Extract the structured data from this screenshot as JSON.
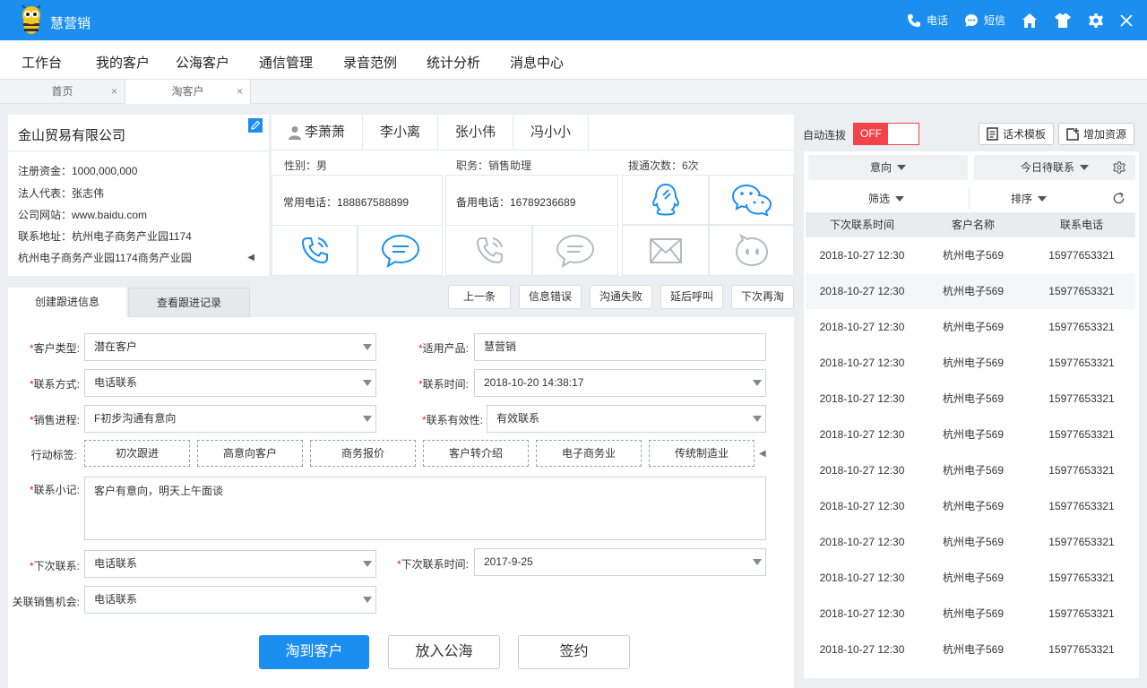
{
  "app": {
    "title": "慧营销"
  },
  "titlebar": {
    "phone_label": "电话",
    "sms_label": "短信"
  },
  "menu": [
    "工作台",
    "我的客户",
    "公海客户",
    "通信管理",
    "录音范例",
    "统计分析",
    "消息中心"
  ],
  "page_tabs": [
    {
      "label": "首页",
      "close": "×"
    },
    {
      "label": "淘客户",
      "close": "×"
    }
  ],
  "company": {
    "name": "金山贸易有限公司",
    "lines": [
      "注册资金：1000,000,000",
      "法人代表：张志伟",
      "公司网站：www.baidu.com",
      "联系地址：杭州电子商务产业园1174",
      "杭州电子商务产业园1174商务产业园"
    ]
  },
  "contacts": {
    "tabs": [
      "李萧萧",
      "李小离",
      "张小伟",
      "冯小小"
    ],
    "gender": "性别：男",
    "position": "职务：销售助理",
    "dial_count": "拨通次数：6次",
    "main_phone": "常用电话：188867588899",
    "backup_phone": "备用电话：16789236689"
  },
  "followup_tabs": [
    "创建跟进信息",
    "查看跟进记录"
  ],
  "action_buttons": [
    "上一条",
    "信息错误",
    "沟通失败",
    "延后呼叫",
    "下次再淘"
  ],
  "form": {
    "req_mark": "*",
    "customer_type": {
      "label": "客户类型:",
      "value": "潜在客户"
    },
    "product": {
      "label": "适用产品:",
      "value": "慧营销"
    },
    "contact_method": {
      "label": "联系方式:",
      "value": "电话联系"
    },
    "contact_time": {
      "label": "联系时间:",
      "value": "2018-10-20 14:38:17"
    },
    "sales_progress": {
      "label": "销售进程:",
      "value": "F初步沟通有意向"
    },
    "validity": {
      "label": "联系有效性:",
      "value": "有效联系"
    },
    "tags_label": "行动标签:",
    "tags": [
      "初次跟进",
      "高意向客户",
      "商务报价",
      "客户转介绍",
      "电子商务业",
      "传统制造业"
    ],
    "note": {
      "label": "联系小记:",
      "value": "客户有意向，明天上午面谈"
    },
    "next_contact": {
      "label": "下次联系:",
      "value": "电话联系"
    },
    "next_time": {
      "label": "下次联系时间:",
      "value": "2017-9-25"
    },
    "opportunity": {
      "label": "关联销售机会:",
      "value": "电话联系"
    }
  },
  "bottom_buttons": [
    "淘到客户",
    "放入公海",
    "签约"
  ],
  "right": {
    "auto_dial_label": "自动连拨",
    "toggle_state": "OFF",
    "script_template": "话术模板",
    "add_resource": "增加资源",
    "filter_intent": "意向",
    "filter_today": "今日待联系",
    "filter_screen": "筛选",
    "filter_sort": "排序",
    "columns": [
      "下次联系时间",
      "客户名称",
      "联系电话"
    ],
    "rows": [
      [
        "2018-10-27 12:30",
        "杭州电子569",
        "15977653321"
      ],
      [
        "2018-10-27 12:30",
        "杭州电子569",
        "15977653321"
      ],
      [
        "2018-10-27 12:30",
        "杭州电子569",
        "15977653321"
      ],
      [
        "2018-10-27 12:30",
        "杭州电子569",
        "15977653321"
      ],
      [
        "2018-10-27 12:30",
        "杭州电子569",
        "15977653321"
      ],
      [
        "2018-10-27 12:30",
        "杭州电子569",
        "15977653321"
      ],
      [
        "2018-10-27 12:30",
        "杭州电子569",
        "15977653321"
      ],
      [
        "2018-10-27 12:30",
        "杭州电子569",
        "15977653321"
      ],
      [
        "2018-10-27 12:30",
        "杭州电子569",
        "15977653321"
      ],
      [
        "2018-10-27 12:30",
        "杭州电子569",
        "15977653321"
      ],
      [
        "2018-10-27 12:30",
        "杭州电子569",
        "15977653321"
      ],
      [
        "2018-10-27 12:30",
        "杭州电子569",
        "15977653321"
      ]
    ]
  },
  "colors": {
    "brand": "#1b8ef0",
    "danger": "#f0434a"
  }
}
